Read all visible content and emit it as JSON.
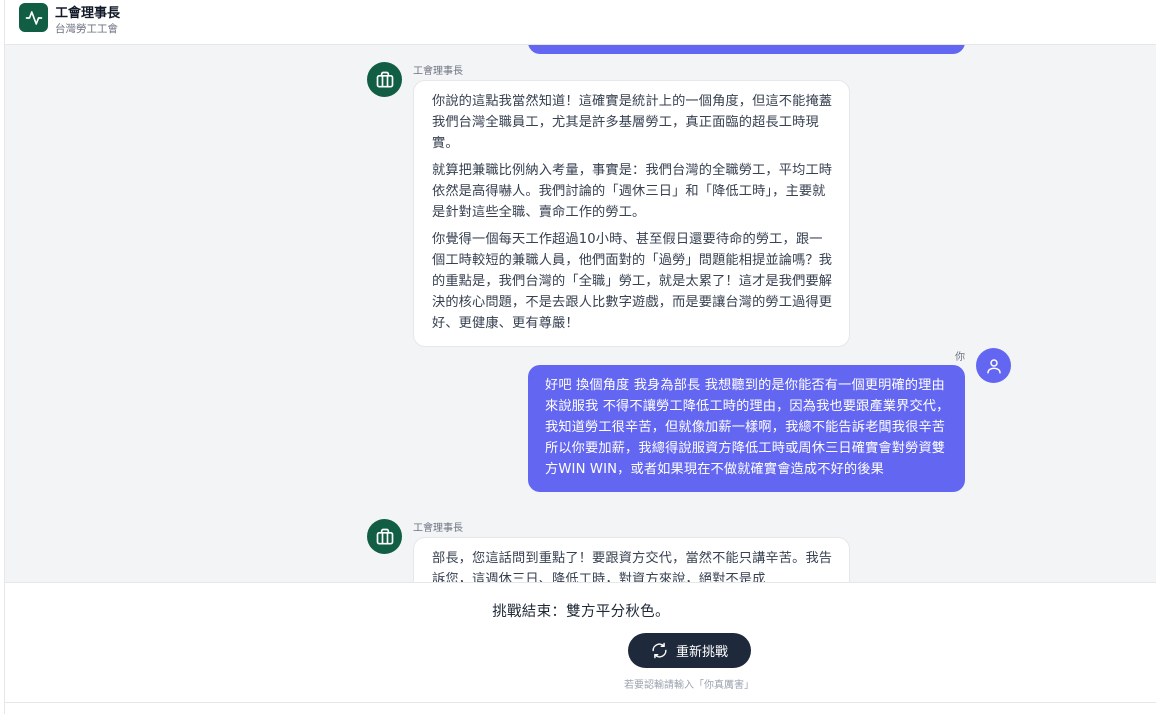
{
  "header": {
    "title": "工會理事長",
    "subtitle": "台灣勞工工會",
    "logo_icon": "activity-pulse-icon"
  },
  "messages": [
    {
      "role": "bot",
      "sender": "工會理事長",
      "paragraphs": [
        "你說的這點我當然知道！這確實是統計上的一個角度，但這不能掩蓋我們台灣全職員工，尤其是許多基層勞工，真正面臨的超長工時現實。",
        "就算把兼職比例納入考量，事實是：我們台灣的全職勞工，平均工時依然是高得嚇人。我們討論的「週休三日」和「降低工時」，主要就是針對這些全職、賣命工作的勞工。",
        "你覺得一個每天工作超過10小時、甚至假日還要待命的勞工，跟一個工時較短的兼職人員，他們面對的「過勞」問題能相提並論嗎？我的重點是，我們台灣的「全職」勞工，就是太累了！這才是我們要解決的核心問題，不是去跟人比數字遊戲，而是要讓台灣的勞工過得更好、更健康、更有尊嚴！"
      ]
    },
    {
      "role": "user",
      "sender": "你",
      "text": "好吧 換個角度 我身為部長 我想聽到的是你能否有一個更明確的理由來說服我 不得不讓勞工降低工時的理由，因為我也要跟產業界交代，我知道勞工很辛苦，但就像加薪一樣啊，我總不能告訴老闆我很辛苦所以你要加薪，我總得說服資方降低工時或周休三日確實會對勞資雙方WIN WIN，或者如果現在不做就確實會造成不好的後果"
    },
    {
      "role": "bot",
      "sender": "工會理事長",
      "paragraphs": [
        "部長，您這話問到重點了！要跟資方交代，當然不能只講辛苦。我告訴您，這週休三日、降低工時，對資方來說，絕對不是成"
      ]
    }
  ],
  "footer": {
    "result": "挑戰結束：雙方平分秋色。",
    "retry_label": "重新挑戰",
    "retry_icon": "refresh-icon",
    "hint": "若要認輸請輸入「你真厲害」"
  },
  "colors": {
    "brand_green": "#115e45",
    "user_bubble": "#6366f1",
    "button_dark": "#1e293b",
    "chat_bg": "#f3f4f6"
  }
}
